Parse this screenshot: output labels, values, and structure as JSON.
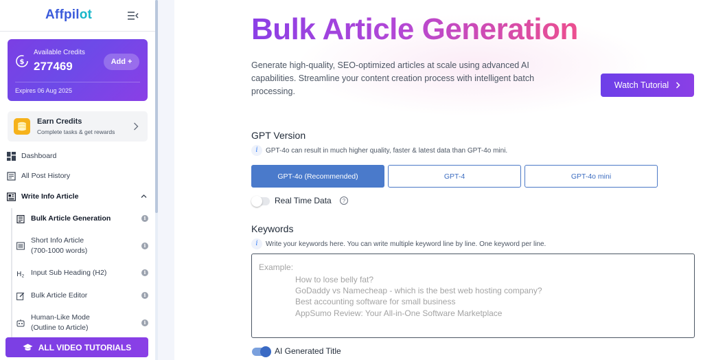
{
  "app": {
    "logo_main": "Affpil",
    "logo_accent": "ot"
  },
  "credits": {
    "label": "Available Credits",
    "value": "277469",
    "add_label": "Add +",
    "expiry": "Expires 06 Aug 2025"
  },
  "earn": {
    "title": "Earn Credits",
    "subtitle": "Complete tasks & get rewards"
  },
  "nav": {
    "dashboard": "Dashboard",
    "history": "All Post History",
    "write_info": "Write Info Article"
  },
  "subnav": [
    {
      "line1": "Bulk Article Generation",
      "line2": ""
    },
    {
      "line1": "Short Info Article",
      "line2": "(700-1000 words)"
    },
    {
      "line1": "Input Sub Heading (H2)",
      "line2": ""
    },
    {
      "line1": "Bulk Article Editor",
      "line2": ""
    },
    {
      "line1": "Human-Like Mode",
      "line2": "(Outline to Article)"
    }
  ],
  "subnav_info_glyph": "i",
  "video_tutorials_label": "ALL VIDEO TUTORIALS",
  "header": {
    "title": "Bulk Article Generation",
    "description": "Generate high-quality, SEO-optimized articles at scale using advanced AI capabilities. Streamline your content creation process with intelligent batch processing.",
    "watch_label": "Watch Tutorial"
  },
  "gpt": {
    "title": "GPT Version",
    "hint": "GPT-4o can result in much higher quality, faster & latest data than GPT-4o mini.",
    "options": [
      "GPT-4o (Recommended)",
      "GPT-4",
      "GPT-4o mini"
    ],
    "selected_index": 0
  },
  "realtime": {
    "label": "Real Time Data",
    "enabled": false,
    "help_glyph": "?"
  },
  "keywords": {
    "title": "Keywords",
    "hint": "Write your keywords here. You can write multiple keyword line by line. One keyword per line.",
    "example_label": "Example:",
    "example_lines": [
      "How to lose belly fat?",
      "GoDaddy vs Namecheap - which is the best web hosting company?",
      "Best accounting software for small business",
      "AppSumo Review: Your All-in-One Software Marketplace"
    ]
  },
  "ai_title": {
    "label": "AI Generated Title",
    "enabled": true
  },
  "hint_glyph": "i",
  "colors": {
    "accent_purple": "#7b3fe4",
    "accent_blue": "#4a7acb",
    "title_pink": "#ec4f8f",
    "earn_gold": "#f6b21b"
  }
}
